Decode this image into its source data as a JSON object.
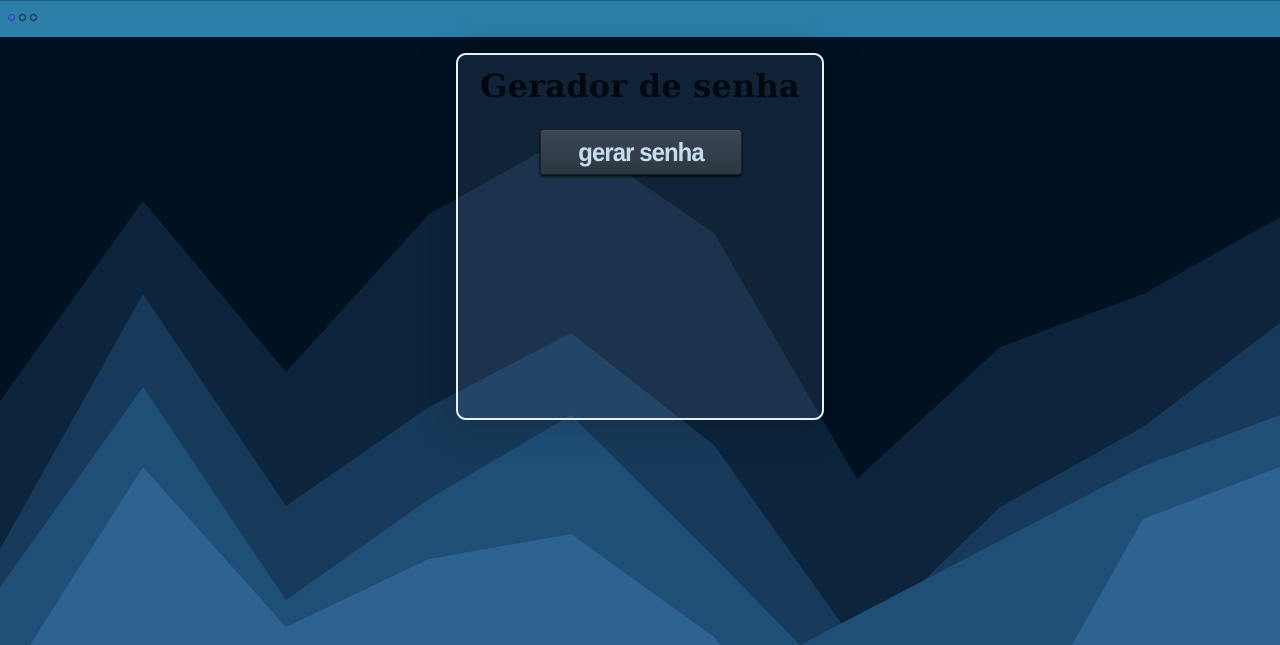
{
  "window": {
    "controls": [
      "close-dot",
      "minimize-dot",
      "maximize-dot"
    ]
  },
  "card": {
    "title": "Gerador de senha",
    "generate_button_label": "gerar senha"
  },
  "colors": {
    "topbar": "#2b7fa8",
    "background": "#001122",
    "wave1": "#0c243c",
    "wave2": "#173a5a",
    "wave3": "#1f4e77",
    "wave4": "#2e6391",
    "button_text": "#c8dcf0"
  }
}
